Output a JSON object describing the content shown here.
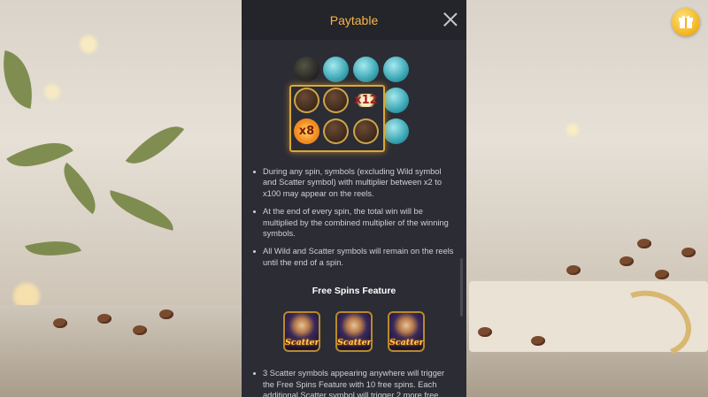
{
  "panel": {
    "title": "Paytable",
    "close_icon": "close-icon",
    "multiplier_labels": [
      "x12",
      "x8"
    ],
    "bullets": [
      "During any spin, symbols (excluding Wild symbol and Scatter symbol) with multiplier between x2 to x100 may appear on the reels.",
      "At the end of every spin, the total win will be multiplied by the combined multiplier of the winning symbols.",
      "All Wild and Scatter symbols will remain on the reels until the end of a spin."
    ],
    "section_title": "Free Spins Feature",
    "scatter_label": "Scatter",
    "bullets2": [
      "3 Scatter symbols appearing anywhere will trigger the Free Spins Feature with 10 free spins. Each additional Scatter symbol will trigger 2 more free"
    ]
  },
  "gift_icon": "gift-icon",
  "colors": {
    "title": "#f3b845",
    "panel": "#2c2c35",
    "header": "#24242b"
  }
}
